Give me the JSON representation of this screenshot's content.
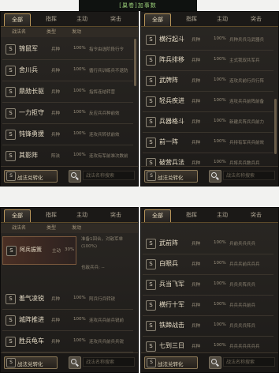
{
  "top_title": "[巢卷]加事数",
  "tabs": [
    "全部",
    "指挥",
    "主动",
    "突击"
  ],
  "headers": [
    "战法名",
    "类型",
    "发动"
  ],
  "icon_letter": "S",
  "spec_button": "战法兑转化",
  "search_placeholder": "战法名称搜索",
  "panels": {
    "tl": {
      "rows": [
        {
          "name": "锦鼠军",
          "type": "兵种",
          "pct": "100%",
          "desc": "指令由选阶段行令"
        },
        {
          "name": "舍川兵",
          "type": "兵种",
          "pct": "100%",
          "desc": "循行兵训练兵不退防"
        },
        {
          "name": "鼎勋长驱",
          "type": "兵种",
          "pct": "100%",
          "desc": "指挥连结转营"
        },
        {
          "name": "一力拒守",
          "type": "兵种",
          "pct": "100%",
          "desc": "反应兵兵种前效"
        },
        {
          "name": "钝锋勇援",
          "type": "兵种",
          "pct": "100%",
          "desc": "连攻兵转状前效"
        },
        {
          "name": "其影阵",
          "type": "阵法",
          "pct": "100%",
          "desc": "连攻有军前准次数前"
        }
      ]
    },
    "tr": {
      "rows": [
        {
          "name": "横行起斗",
          "type": "兵种",
          "pct": "100%",
          "desc": "兵种兵兵马武器兵"
        },
        {
          "name": "阵兵排移",
          "type": "兵种",
          "pct": "100%",
          "desc": "主式我双共军兵"
        },
        {
          "name": "武牌阵",
          "type": "兵种",
          "pct": "100%",
          "desc": "连攻兵前行兵行阵"
        },
        {
          "name": "轻兵疾进",
          "type": "兵种",
          "pct": "100%",
          "desc": "连攻兵兵前阵前备"
        },
        {
          "name": "兵器格斗",
          "type": "兵种",
          "pct": "100%",
          "desc": "新建兵阵兵兵前力"
        },
        {
          "name": "前一阵",
          "type": "兵种",
          "pct": "100%",
          "desc": "兵持有军兵兵前效"
        },
        {
          "name": "破营兵法",
          "type": "兵种",
          "pct": "100%",
          "desc": "兵将兵兵数兵兵"
        }
      ]
    },
    "bl": {
      "selected": {
        "name": "阿兵振策",
        "type": "主动",
        "pct": "30%"
      },
      "detail": [
        "准备1回合，对敌军单",
        "(100%)",
        "",
        "",
        "也敌兵兵: --"
      ],
      "rows": [
        {
          "name": "羞气凌锐",
          "type": "兵种",
          "pct": "100%",
          "desc": "阿兵行兵转锐"
        },
        {
          "name": "城阵推进",
          "type": "兵种",
          "pct": "100%",
          "desc": "连攻兵兵前兵锐前"
        },
        {
          "name": "胜兵龟车",
          "type": "兵种",
          "pct": "100%",
          "desc": "连攻兵兵前兵兵锐"
        }
      ]
    },
    "br": {
      "rows": [
        {
          "name": "武前阵",
          "type": "兵种",
          "pct": "100%",
          "desc": "兵前兵兵兵兵"
        },
        {
          "name": "白眼兵",
          "type": "兵种",
          "pct": "100%",
          "desc": "兵兵兵前兵兵兵"
        },
        {
          "name": "兵当飞军",
          "type": "兵种",
          "pct": "100%",
          "desc": "兵兵兵阵兵兵"
        },
        {
          "name": "横行十军",
          "type": "兵种",
          "pct": "100%",
          "desc": "兵兵兵兵前兵"
        },
        {
          "name": "铁蹄战击",
          "type": "兵种",
          "pct": "100%",
          "desc": "兵兵兵兵阵兵"
        },
        {
          "name": "七到三日",
          "type": "兵种",
          "pct": "100%",
          "desc": "兵兵兵兵兵兵兵"
        }
      ]
    }
  }
}
